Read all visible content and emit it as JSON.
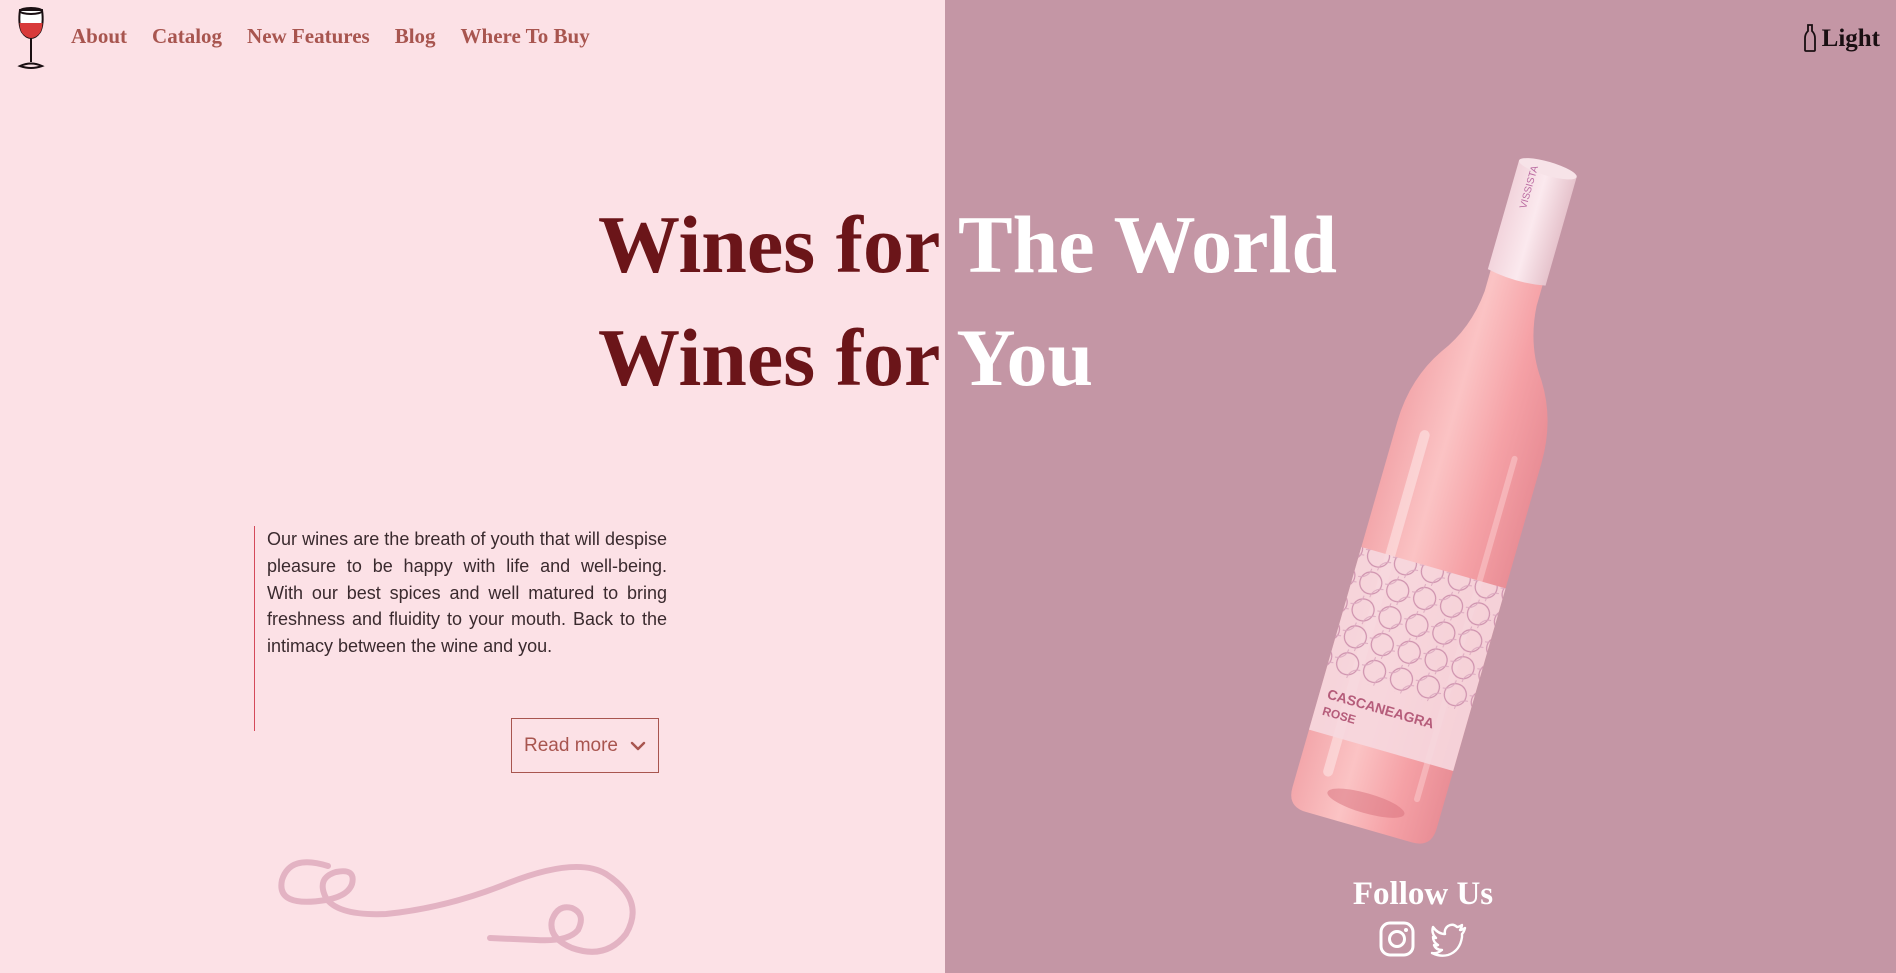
{
  "nav": {
    "items": [
      {
        "label": "About"
      },
      {
        "label": "Catalog"
      },
      {
        "label": "New Features"
      },
      {
        "label": "Blog"
      },
      {
        "label": "Where To Buy"
      }
    ]
  },
  "theme_toggle": {
    "label": "Light",
    "icon": "bottle-icon"
  },
  "hero": {
    "line1_dark": "Wines for ",
    "line1_light": "The World",
    "line2_dark": "Wines for ",
    "line2_light": "You"
  },
  "description": {
    "text": "Our wines are the breath of youth that will despise pleasure to be happy with life and well-being. With our best spices and well matured to bring freshness and fluidity to your mouth. Back to the intimacy between the wine and you.",
    "read_more": "Read more"
  },
  "social": {
    "heading": "Follow Us",
    "icons": [
      "instagram-icon",
      "twitter-icon"
    ]
  },
  "colors": {
    "left_bg": "#fce1e6",
    "right_bg": "#c496a5",
    "nav_text": "#a8554f",
    "headline_dark": "#6b1519",
    "headline_light": "#ffffff",
    "accent_line": "#d44a5a"
  }
}
